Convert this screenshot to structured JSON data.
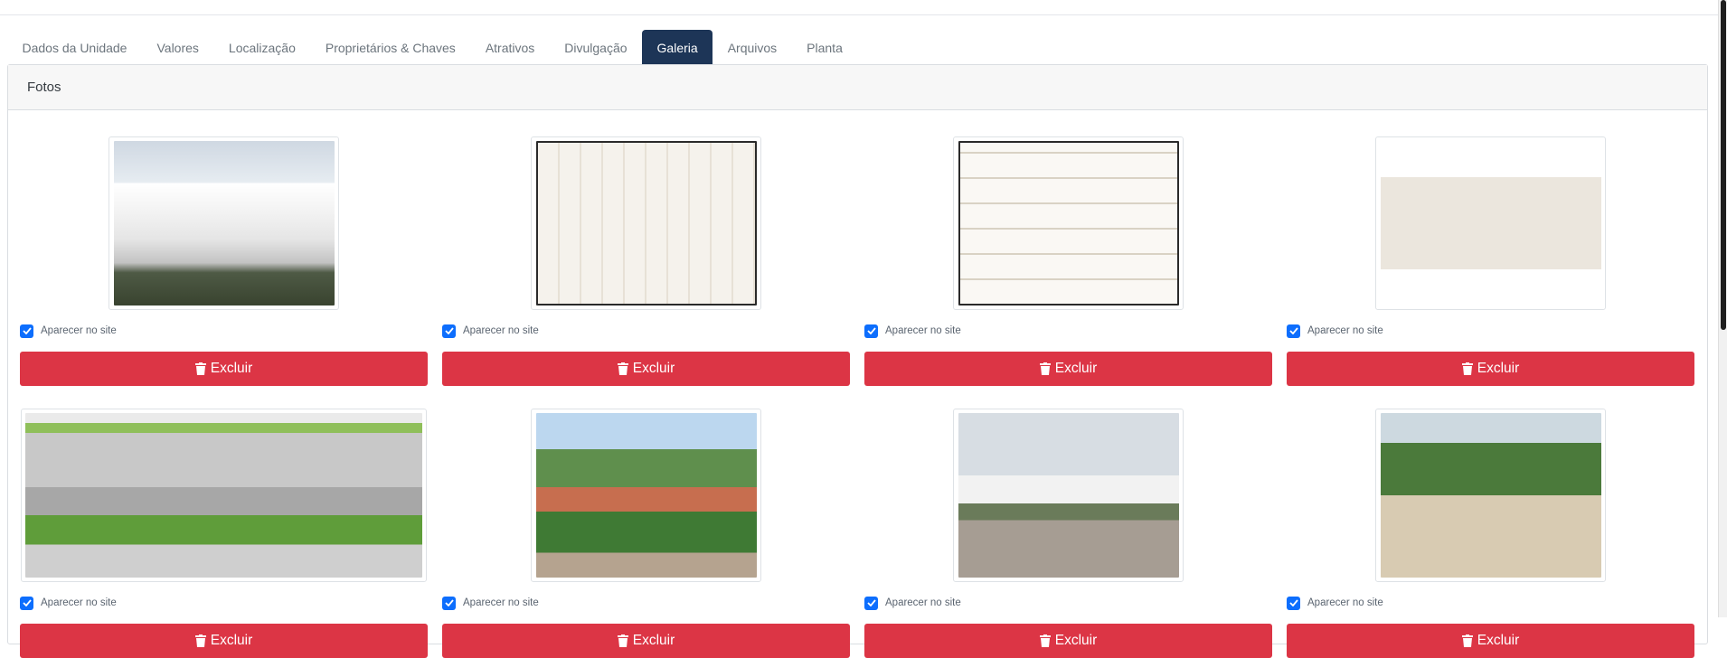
{
  "tabs": [
    {
      "label": "Dados da Unidade",
      "active": false
    },
    {
      "label": "Valores",
      "active": false
    },
    {
      "label": "Localização",
      "active": false
    },
    {
      "label": "Proprietários & Chaves",
      "active": false
    },
    {
      "label": "Atrativos",
      "active": false
    },
    {
      "label": "Divulgação",
      "active": false
    },
    {
      "label": "Galeria",
      "active": true
    },
    {
      "label": "Arquivos",
      "active": false
    },
    {
      "label": "Planta",
      "active": false
    }
  ],
  "gallery": {
    "title": "Fotos",
    "photos": [
      {
        "checked": true,
        "check_label": "Aparecer no site",
        "delete_label": "Excluir"
      },
      {
        "checked": true,
        "check_label": "Aparecer no site",
        "delete_label": "Excluir"
      },
      {
        "checked": true,
        "check_label": "Aparecer no site",
        "delete_label": "Excluir"
      },
      {
        "checked": true,
        "check_label": "Aparecer no site",
        "delete_label": "Excluir"
      },
      {
        "checked": true,
        "check_label": "Aparecer no site",
        "delete_label": "Excluir"
      },
      {
        "checked": true,
        "check_label": "Aparecer no site",
        "delete_label": "Excluir"
      },
      {
        "checked": true,
        "check_label": "Aparecer no site",
        "delete_label": "Excluir"
      },
      {
        "checked": true,
        "check_label": "Aparecer no site",
        "delete_label": "Excluir"
      }
    ]
  },
  "icons": {
    "delete": "trash-icon",
    "checkbox": "checkmark-icon"
  },
  "colors": {
    "active_tab": "#1d3557",
    "danger": "#dc3545",
    "checkbox": "#0d6efd"
  }
}
